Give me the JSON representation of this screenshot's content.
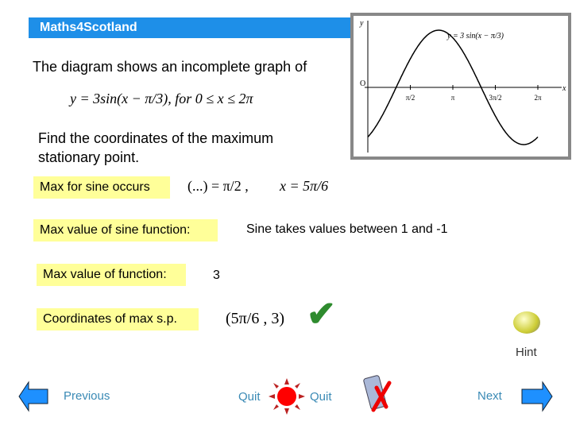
{
  "header": {
    "title": "Maths4Scotland"
  },
  "graph": {
    "equation": "y = 3 sin(x − π/3)",
    "y_label": "y",
    "x_label": "x",
    "origin_label": "O",
    "ticks": [
      "π/2",
      "π",
      "3π/2",
      "2π"
    ],
    "amplitude": 3,
    "phase": "π/3"
  },
  "question": {
    "intro": "The diagram shows an incomplete graph of",
    "function": "y = 3sin(x − π/3),  for 0 ≤ x ≤ 2π",
    "task": "Find the coordinates of the maximum stationary point."
  },
  "steps": [
    {
      "label": "Max for sine occurs",
      "answer1": "(...) = π/2 ,",
      "answer2": "x = 5π/6"
    },
    {
      "label": "Max value of sine function:",
      "answer": "Sine takes values between 1 and -1"
    },
    {
      "label": "Max value of function:",
      "answer": "3"
    },
    {
      "label": "Coordinates of max s.p.",
      "answer": "(5π/6 , 3)"
    }
  ],
  "nav": {
    "hint": "Hint",
    "previous": "Previous",
    "quit1": "Quit",
    "quit2": "Quit",
    "next": "Next"
  },
  "colors": {
    "title_bar": "#1e8fe8",
    "label_box": "#ffff99",
    "nav_text": "#3a8ab5",
    "arrow": "#1e90ff",
    "tick": "#2e8b2e"
  }
}
